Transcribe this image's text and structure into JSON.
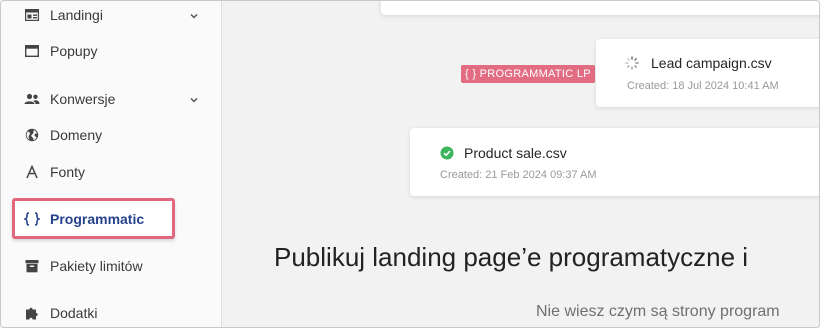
{
  "sidebar": {
    "items": [
      {
        "id": "landingi",
        "label": "Landingi",
        "icon": "layout-icon",
        "chevron": true
      },
      {
        "id": "popupy",
        "label": "Popupy",
        "icon": "window-icon",
        "chevron": false
      },
      {
        "id": "konwersje",
        "label": "Konwersje",
        "icon": "users-icon",
        "chevron": true
      },
      {
        "id": "domeny",
        "label": "Domeny",
        "icon": "globe-icon",
        "chevron": false
      },
      {
        "id": "fonty",
        "label": "Fonty",
        "icon": "font-icon",
        "chevron": false
      },
      {
        "id": "programmatic",
        "label": "Programmatic",
        "icon": "braces-icon",
        "chevron": false,
        "active": true
      },
      {
        "id": "pakiety",
        "label": "Pakiety limitów",
        "icon": "archive-icon",
        "chevron": false
      },
      {
        "id": "dodatki",
        "label": "Dodatki",
        "icon": "puzzle-icon",
        "chevron": false
      }
    ]
  },
  "main": {
    "badge": "{ } PROGRAMMATIC LP",
    "files": [
      {
        "name": "Lead campaign.csv",
        "created": "Created: 18 Jul 2024 10:41 AM",
        "status": "loading"
      },
      {
        "name": "Product sale.csv",
        "created": "Created: 21 Feb 2024 09:37 AM",
        "status": "done"
      }
    ],
    "headline": "Publikuj landing page’e programatyczne i",
    "subline": "Nie wiesz czym są strony program"
  },
  "colors": {
    "accent": "#27428c",
    "highlight": "#e0677e",
    "badge": "#e26d82",
    "success": "#3cb55d"
  }
}
